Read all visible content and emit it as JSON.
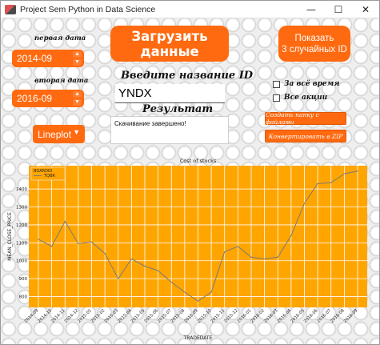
{
  "window": {
    "title": "Project Sem Python in Data Science",
    "minimize_glyph": "—",
    "maximize_glyph": "☐",
    "close_glyph": "✕"
  },
  "form": {
    "first_date_label": "первая дата",
    "first_date_value": "2014-09",
    "second_date_label": "вторая дата",
    "second_date_value": "2016-09",
    "load_button": "Загрузить данные",
    "random_button_line1": "Показать",
    "random_button_line2": "3 случайных ID",
    "id_label": "Введите название ID",
    "id_value": "YNDX",
    "result_label": "Результат",
    "result_text": "Скачивание завершено!",
    "all_time_label": "За всё время",
    "all_stocks_label": "Все акции",
    "create_folder_button": "Создать папку с файлами",
    "convert_zip_button": "Конвертировать в ZIP",
    "plot_type_value": "Lineplot",
    "accent_color": "#ff6a10"
  },
  "chart_data": {
    "type": "line",
    "title": "Cost of stocks",
    "xlabel": "TRADEDATE",
    "ylabel": "MEAN_CLOSE_PRICE",
    "legend_title": "BOARDID",
    "series": [
      {
        "name": "TQBR",
        "color": "#7a7a7a",
        "values": [
          1120,
          1080,
          1220,
          1095,
          1105,
          1040,
          900,
          1010,
          970,
          945,
          880,
          825,
          775,
          825,
          1050,
          1080,
          1020,
          1010,
          1020,
          1140,
          1320,
          1430,
          1435,
          1485,
          1500
        ]
      }
    ],
    "x": [
      "2014-09",
      "2014-10",
      "2014-11",
      "2014-12",
      "2015-01",
      "2015-02",
      "2015-03",
      "2015-04",
      "2015-05",
      "2015-06",
      "2015-07",
      "2015-08",
      "2015-09",
      "2015-10",
      "2015-11",
      "2015-12",
      "2016-01",
      "2016-02",
      "2016-03",
      "2016-04",
      "2016-05",
      "2016-06",
      "2016-07",
      "2016-08",
      "2016-09"
    ],
    "x_tick_labels": [
      "2014-09",
      "2014-10",
      "2014-11",
      "2014-12",
      "2015-01",
      "2015-02",
      "2015-03",
      "2015-04",
      "2015-05",
      "2015-06",
      "2015-07",
      "2015-08",
      "2015-09",
      "2015-10",
      "2015-11",
      "2015-12",
      "2016-01",
      "2016-02",
      "2016-03",
      "2016-04",
      "2016-05",
      "2016-06",
      "2016-07",
      "2016-08",
      "2016-09"
    ],
    "y_ticks": [
      800,
      900,
      1000,
      1100,
      1200,
      1300,
      1400
    ],
    "ylim": [
      740,
      1530
    ],
    "grid": true,
    "legend_position": "top-left",
    "background": "#ffa500",
    "grid_color": "#ffffff"
  }
}
